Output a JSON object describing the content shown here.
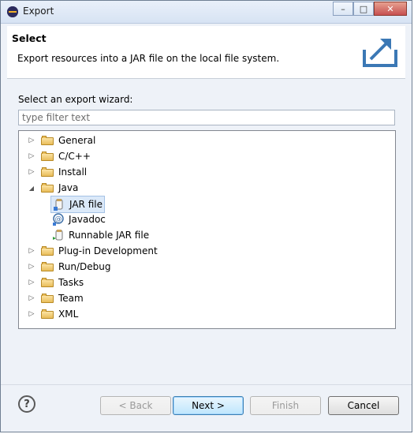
{
  "window": {
    "title": "Export",
    "controls": {
      "minimize": "–",
      "maximize": "□",
      "close": "✕"
    }
  },
  "header": {
    "title": "Select",
    "description": "Export resources into a JAR file on the local file system."
  },
  "wizard_label": "Select an export wizard:",
  "filter": {
    "placeholder": "type filter text",
    "value": ""
  },
  "tree": [
    {
      "label": "General",
      "expanded": false
    },
    {
      "label": "C/C++",
      "expanded": false
    },
    {
      "label": "Install",
      "expanded": false
    },
    {
      "label": "Java",
      "expanded": true,
      "children": [
        {
          "label": "JAR file",
          "selected": true,
          "icon": "jar-file-icon"
        },
        {
          "label": "Javadoc",
          "icon": "javadoc-icon"
        },
        {
          "label": "Runnable JAR file",
          "icon": "runnable-jar-icon"
        }
      ]
    },
    {
      "label": "Plug-in Development",
      "expanded": false
    },
    {
      "label": "Run/Debug",
      "expanded": false
    },
    {
      "label": "Tasks",
      "expanded": false
    },
    {
      "label": "Team",
      "expanded": false
    },
    {
      "label": "XML",
      "expanded": false
    }
  ],
  "buttons": {
    "back": "< Back",
    "next": "Next >",
    "finish": "Finish",
    "cancel": "Cancel"
  },
  "icons": {
    "collapsed": "▷",
    "expanded": "◢",
    "help": "?"
  }
}
